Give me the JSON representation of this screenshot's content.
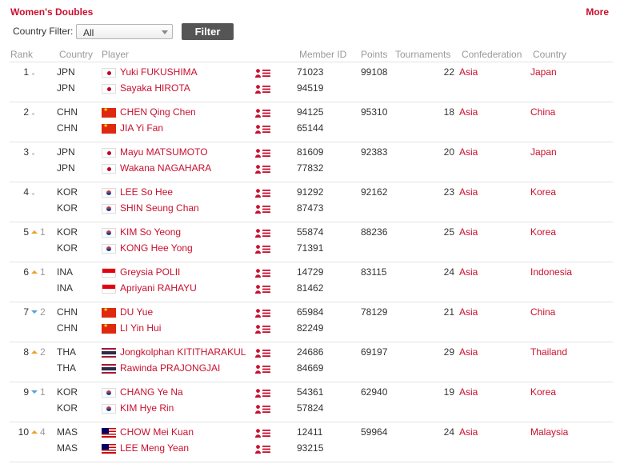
{
  "header": {
    "title": "Women's Doubles",
    "more_label": "More"
  },
  "filter": {
    "label": "Country Filter:",
    "selected": "All",
    "button_label": "Filter"
  },
  "columns": {
    "rank": "Rank",
    "country": "Country",
    "player": "Player",
    "member_id": "Member ID",
    "points": "Points",
    "tournaments": "Tournaments",
    "confederation": "Confederation",
    "country_name": "Country"
  },
  "rows": [
    {
      "rank": "1",
      "change_dir": "none",
      "change": "",
      "players": [
        {
          "code": "JPN",
          "flag": "jpn",
          "name": "Yuki FUKUSHIMA",
          "member_id": "71023"
        },
        {
          "code": "JPN",
          "flag": "jpn",
          "name": "Sayaka HIROTA",
          "member_id": "94519"
        }
      ],
      "points": "99108",
      "tournaments": "22",
      "confederation": "Asia",
      "country": "Japan"
    },
    {
      "rank": "2",
      "change_dir": "none",
      "change": "",
      "players": [
        {
          "code": "CHN",
          "flag": "chn",
          "name": "CHEN Qing Chen",
          "member_id": "94125"
        },
        {
          "code": "CHN",
          "flag": "chn",
          "name": "JIA Yi Fan",
          "member_id": "65144"
        }
      ],
      "points": "95310",
      "tournaments": "18",
      "confederation": "Asia",
      "country": "China"
    },
    {
      "rank": "3",
      "change_dir": "none",
      "change": "",
      "players": [
        {
          "code": "JPN",
          "flag": "jpn",
          "name": "Mayu MATSUMOTO",
          "member_id": "81609"
        },
        {
          "code": "JPN",
          "flag": "jpn",
          "name": "Wakana NAGAHARA",
          "member_id": "77832"
        }
      ],
      "points": "92383",
      "tournaments": "20",
      "confederation": "Asia",
      "country": "Japan"
    },
    {
      "rank": "4",
      "change_dir": "none",
      "change": "",
      "players": [
        {
          "code": "KOR",
          "flag": "kor",
          "name": "LEE So Hee",
          "member_id": "91292"
        },
        {
          "code": "KOR",
          "flag": "kor",
          "name": "SHIN Seung Chan",
          "member_id": "87473"
        }
      ],
      "points": "92162",
      "tournaments": "23",
      "confederation": "Asia",
      "country": "Korea"
    },
    {
      "rank": "5",
      "change_dir": "up",
      "change": "1",
      "players": [
        {
          "code": "KOR",
          "flag": "kor",
          "name": "KIM So Yeong",
          "member_id": "55874"
        },
        {
          "code": "KOR",
          "flag": "kor",
          "name": "KONG Hee Yong",
          "member_id": "71391"
        }
      ],
      "points": "88236",
      "tournaments": "25",
      "confederation": "Asia",
      "country": "Korea"
    },
    {
      "rank": "6",
      "change_dir": "up",
      "change": "1",
      "players": [
        {
          "code": "INA",
          "flag": "ina",
          "name": "Greysia POLII",
          "member_id": "14729"
        },
        {
          "code": "INA",
          "flag": "ina",
          "name": "Apriyani RAHAYU",
          "member_id": "81462"
        }
      ],
      "points": "83115",
      "tournaments": "24",
      "confederation": "Asia",
      "country": "Indonesia"
    },
    {
      "rank": "7",
      "change_dir": "down",
      "change": "2",
      "players": [
        {
          "code": "CHN",
          "flag": "chn",
          "name": "DU Yue",
          "member_id": "65984"
        },
        {
          "code": "CHN",
          "flag": "chn",
          "name": "LI Yin Hui",
          "member_id": "82249"
        }
      ],
      "points": "78129",
      "tournaments": "21",
      "confederation": "Asia",
      "country": "China"
    },
    {
      "rank": "8",
      "change_dir": "up",
      "change": "2",
      "players": [
        {
          "code": "THA",
          "flag": "tha",
          "name": "Jongkolphan KITITHARAKUL",
          "member_id": "24686"
        },
        {
          "code": "THA",
          "flag": "tha",
          "name": "Rawinda PRAJONGJAI",
          "member_id": "84669"
        }
      ],
      "points": "69197",
      "tournaments": "29",
      "confederation": "Asia",
      "country": "Thailand"
    },
    {
      "rank": "9",
      "change_dir": "down",
      "change": "1",
      "players": [
        {
          "code": "KOR",
          "flag": "kor",
          "name": "CHANG Ye Na",
          "member_id": "54361"
        },
        {
          "code": "KOR",
          "flag": "kor",
          "name": "KIM Hye Rin",
          "member_id": "57824"
        }
      ],
      "points": "62940",
      "tournaments": "19",
      "confederation": "Asia",
      "country": "Korea"
    },
    {
      "rank": "10",
      "change_dir": "up",
      "change": "4",
      "players": [
        {
          "code": "MAS",
          "flag": "mas",
          "name": "CHOW Mei Kuan",
          "member_id": "12411"
        },
        {
          "code": "MAS",
          "flag": "mas",
          "name": "LEE Meng Yean",
          "member_id": "93215"
        }
      ],
      "points": "59964",
      "tournaments": "24",
      "confederation": "Asia",
      "country": "Malaysia"
    }
  ],
  "icons": {
    "flag": "country-flag-icon",
    "profile": "player-profile-icon"
  }
}
